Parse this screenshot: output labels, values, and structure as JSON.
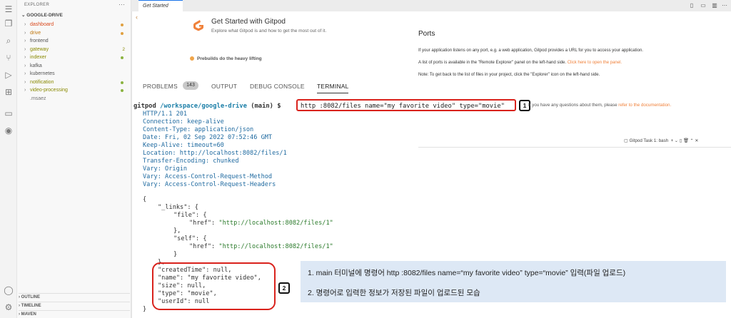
{
  "explorer": {
    "title": "EXPLORER",
    "root": "GOOGLE-DRIVE",
    "items": [
      {
        "label": "dashboard",
        "color": "#d9481c",
        "marker": "dot",
        "marker_color": "#e0a040"
      },
      {
        "label": "drive",
        "color": "#c0780f",
        "marker": "dot",
        "marker_color": "#e0a040"
      },
      {
        "label": "frontend",
        "color": "#555555",
        "marker": "",
        "marker_color": ""
      },
      {
        "label": "gateway",
        "color": "#8a8a00",
        "marker": "2",
        "marker_color": "#8a8a00"
      },
      {
        "label": "indexer",
        "color": "#8a8a00",
        "marker": "dot",
        "marker_color": "#8ab340"
      },
      {
        "label": "kafka",
        "color": "#555555",
        "marker": "",
        "marker_color": ""
      },
      {
        "label": "kubernetes",
        "color": "#555555",
        "marker": "",
        "marker_color": ""
      },
      {
        "label": "notification",
        "color": "#8a8a00",
        "marker": "dot",
        "marker_color": "#8ab340"
      },
      {
        "label": "video-processing",
        "color": "#8a8a00",
        "marker": "dot",
        "marker_color": "#8ab340"
      },
      {
        "label": ".msaez",
        "color": "#777777",
        "marker": "",
        "marker_color": ""
      }
    ],
    "sections": [
      "OUTLINE",
      "TIMELINE",
      "MAVEN"
    ]
  },
  "tab": {
    "label": "Get Started"
  },
  "welcome": {
    "title": "Get Started with Gitpod",
    "subtitle": "Explore what Gitpod is and how to get the most out of it.",
    "prebuilds": "Prebuilds do the heavy lifting"
  },
  "ports": {
    "title": "Ports",
    "p1": "If your application listens on any port, e.g. a web application, Gitpod provides a URL for you to access your application.",
    "p2_text": "A list of ports is available in the \"Remote Explorer\" panel on the left-hand side.",
    "p2_link": "Click here to open the panel.",
    "p3": "Note: To get back to the list of files in your project, click the \"Explorer\" icon on the left-hand side.",
    "p4_text": "If you have any questions about them, please",
    "p4_link": "refer to the documentation."
  },
  "panel": {
    "tabs": [
      "PROBLEMS",
      "OUTPUT",
      "DEBUG CONSOLE",
      "TERMINAL"
    ],
    "problems_count": "143"
  },
  "task": {
    "label": "Gitpod Task 1: bash"
  },
  "terminal": {
    "prompt_user": "gitpod",
    "prompt_path": "/workspace/google-drive",
    "prompt_branch": "(main) $",
    "command": "http :8082/files name=\"my favorite video\" type=\"movie\"",
    "headers": [
      "HTTP/1.1 201",
      "Connection: keep-alive",
      "Content-Type: application/json",
      "Date: Fri, 02 Sep 2022 07:52:46 GMT",
      "Keep-Alive: timeout=60",
      "Location: http://localhost:8082/files/1",
      "Transfer-Encoding: chunked",
      "Vary: Origin",
      "Vary: Access-Control-Request-Method",
      "Vary: Access-Control-Request-Headers"
    ],
    "json": {
      "open": "{",
      "links_key": "\"_links\": {",
      "file_key": "\"file\": {",
      "self_key": "\"self\": {",
      "href_key": "\"href\": ",
      "href_value": "\"http://localhost:8082/files/1\"",
      "close_inner": "},",
      "close_inner_last": "}",
      "close_links": "},",
      "created": "\"createdTime\": null,",
      "name": "\"name\": \"my favorite video\",",
      "size": "\"size\": null,",
      "type": "\"type\": \"movie\",",
      "user": "\"userId\": null",
      "close": "}"
    }
  },
  "markers": {
    "one": "1",
    "two": "2"
  },
  "annotation": {
    "line1": "1. main 터미널에 명령어 http :8082/files name=“my favorite video” type=“movie” 입력(파일 업로드)",
    "line2": "2. 명령어로 입력한 정보가 저장된 파일이 업로드된 모습"
  },
  "colors": {
    "accent_red": "#d9221c",
    "callout_bg": "#dde8f5",
    "gitpod_orange": "#f0813a"
  }
}
